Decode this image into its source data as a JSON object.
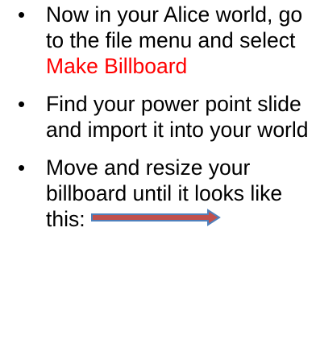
{
  "slide": {
    "bullets": [
      {
        "text_before": "Now in your Alice world, go to the file menu and select ",
        "highlight": "Make Billboard"
      },
      {
        "text": "Find your power point slide and import it into your world"
      },
      {
        "text": "Move and resize your billboard until it looks like this:"
      }
    ],
    "bullet_glyph": "•",
    "arrow_icon": "right-arrow-icon",
    "colors": {
      "text": "#000000",
      "highlight": "#ff0000",
      "arrow_fill": "#c0504d",
      "arrow_stroke": "#4f81bd"
    }
  }
}
